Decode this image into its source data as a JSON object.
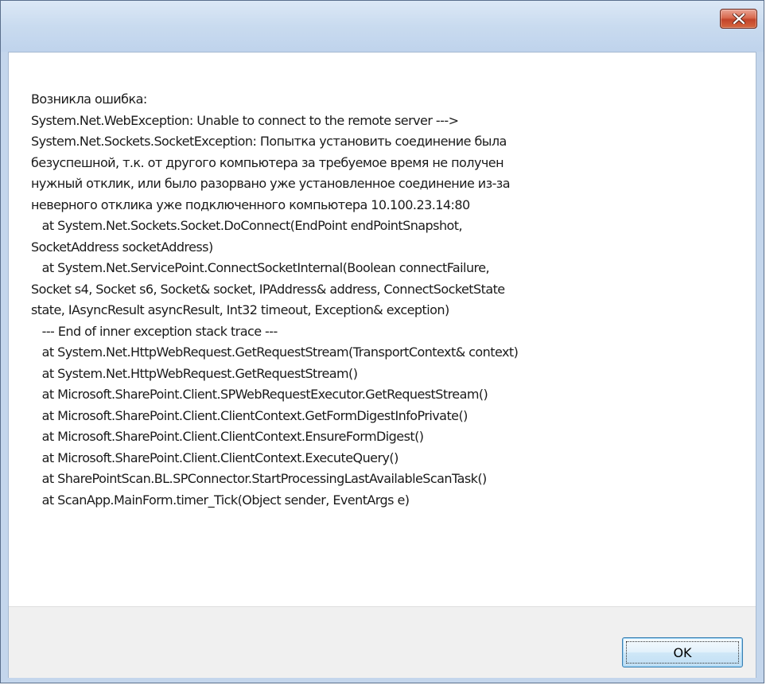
{
  "window": {
    "title": "",
    "close_icon": "close-icon"
  },
  "dialog": {
    "message_lines": [
      "Возникла ошибка:",
      "System.Net.WebException: Unable to connect to the remote server --->",
      "System.Net.Sockets.SocketException: Попытка установить соединение была",
      "безуспешной, т.к. от другого компьютера за требуемое время не получен",
      "нужный отклик, или было разорвано уже установленное соединение из-за",
      "неверного отклика уже подключенного компьютера 10.100.23.14:80",
      "   at System.Net.Sockets.Socket.DoConnect(EndPoint endPointSnapshot,",
      "SocketAddress socketAddress)",
      "   at System.Net.ServicePoint.ConnectSocketInternal(Boolean connectFailure,",
      "Socket s4, Socket s6, Socket& socket, IPAddress& address, ConnectSocketState",
      "state, IAsyncResult asyncResult, Int32 timeout, Exception& exception)",
      "   --- End of inner exception stack trace ---",
      "   at System.Net.HttpWebRequest.GetRequestStream(TransportContext& context)",
      "   at System.Net.HttpWebRequest.GetRequestStream()",
      "   at Microsoft.SharePoint.Client.SPWebRequestExecutor.GetRequestStream()",
      "   at Microsoft.SharePoint.Client.ClientContext.GetFormDigestInfoPrivate()",
      "   at Microsoft.SharePoint.Client.ClientContext.EnsureFormDigest()",
      "   at Microsoft.SharePoint.Client.ClientContext.ExecuteQuery()",
      "   at SharePointScan.BL.SPConnector.StartProcessingLastAvailableScanTask()",
      "   at ScanApp.MainForm.timer_Tick(Object sender, EventArgs e)"
    ],
    "ok_label": "OK"
  },
  "colors": {
    "titlebar": "#c9dbef",
    "close_button": "#c3442a",
    "footer": "#f0f0f0",
    "ok_border": "#3c7fb1"
  }
}
